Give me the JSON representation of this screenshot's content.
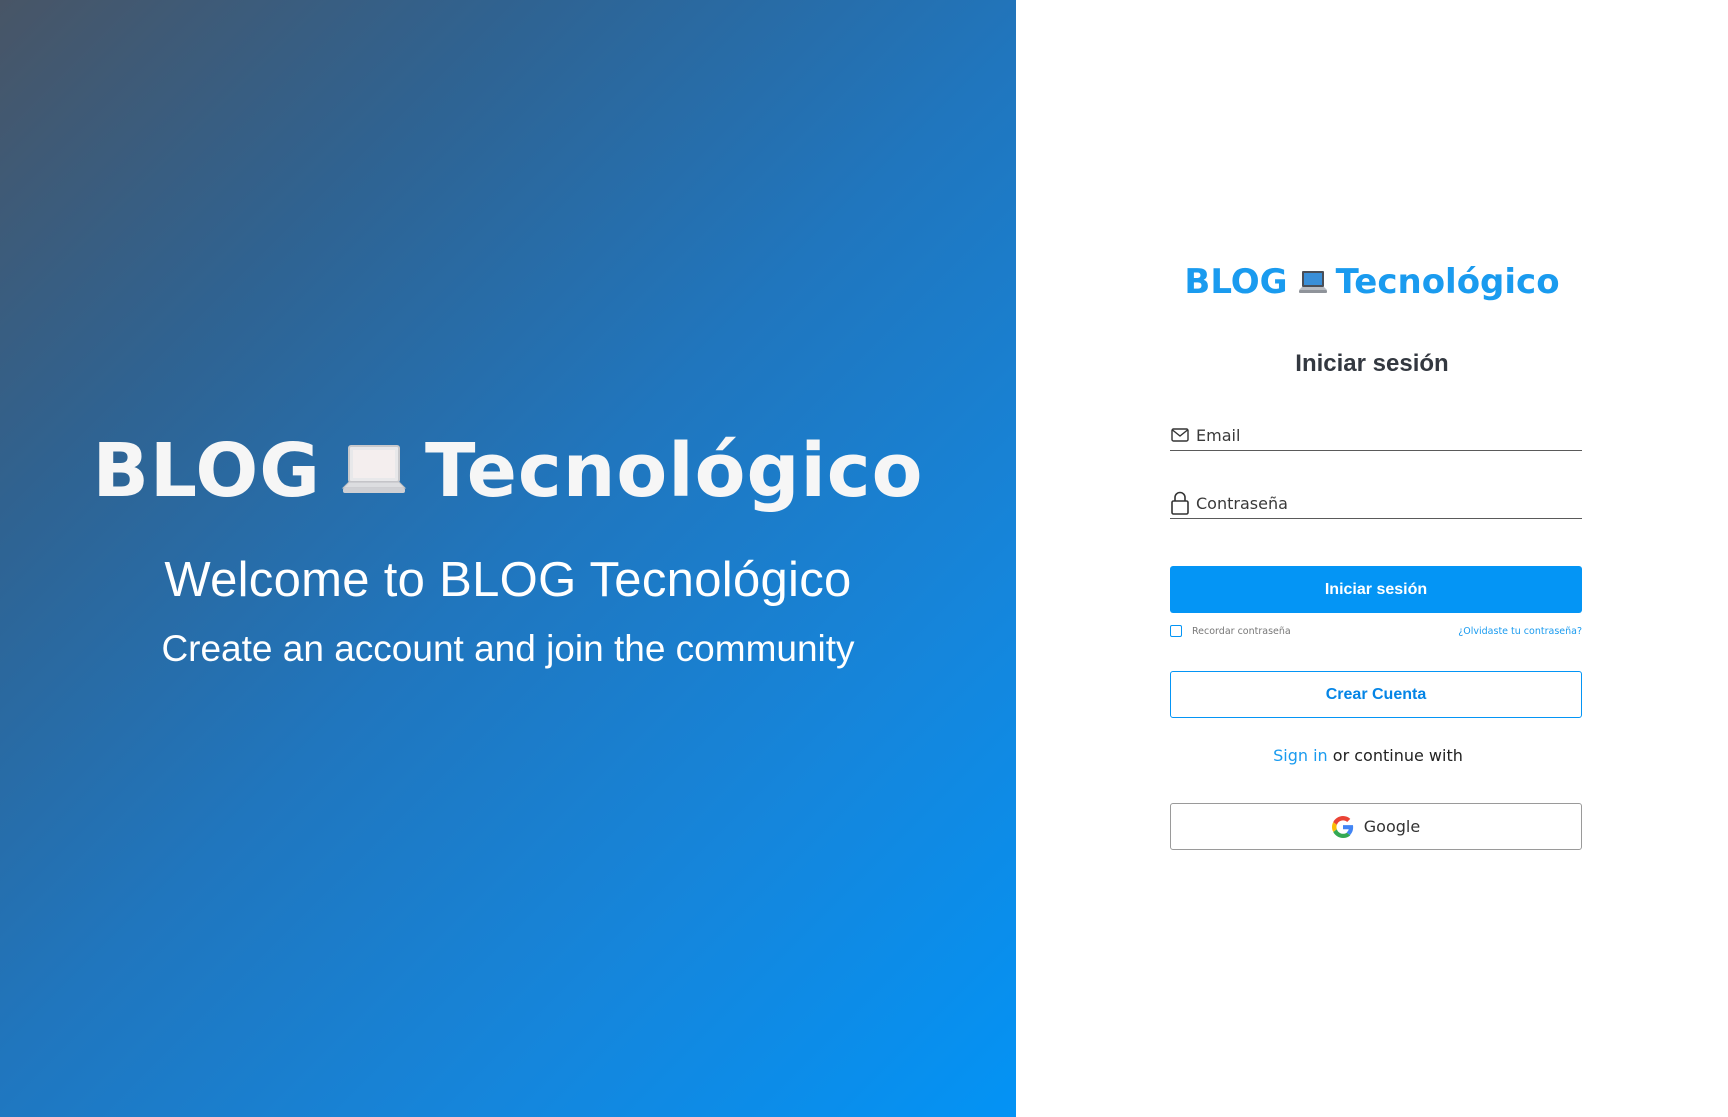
{
  "hero": {
    "logo_left": "BLOG",
    "logo_right": "Tecnológico",
    "logo_icon": "laptop-icon",
    "title": "Welcome to BLOG Tecnológico",
    "subtitle": "Create an account and join the community"
  },
  "form": {
    "logo_left": "BLOG",
    "logo_right": "Tecnológico",
    "logo_icon": "laptop-icon",
    "heading": "Iniciar sesión",
    "email_placeholder": "Email",
    "email_icon": "envelope-icon",
    "password_placeholder": "Contraseña",
    "password_icon": "lock-icon",
    "submit_label": "Iniciar sesión",
    "remember_label": "Recordar contraseña",
    "forgot_label": "¿Olvidaste tu contraseña?",
    "create_account_label": "Crear Cuenta",
    "sign_in_link": "Sign in",
    "continue_text": "or continue with",
    "google_label": "Google",
    "google_icon": "google-icon"
  },
  "colors": {
    "accent": "#0495f5",
    "brand_text": "#1a9bef",
    "heading": "#333840",
    "gradient_start": "#485566",
    "gradient_end": "#0393f5"
  }
}
